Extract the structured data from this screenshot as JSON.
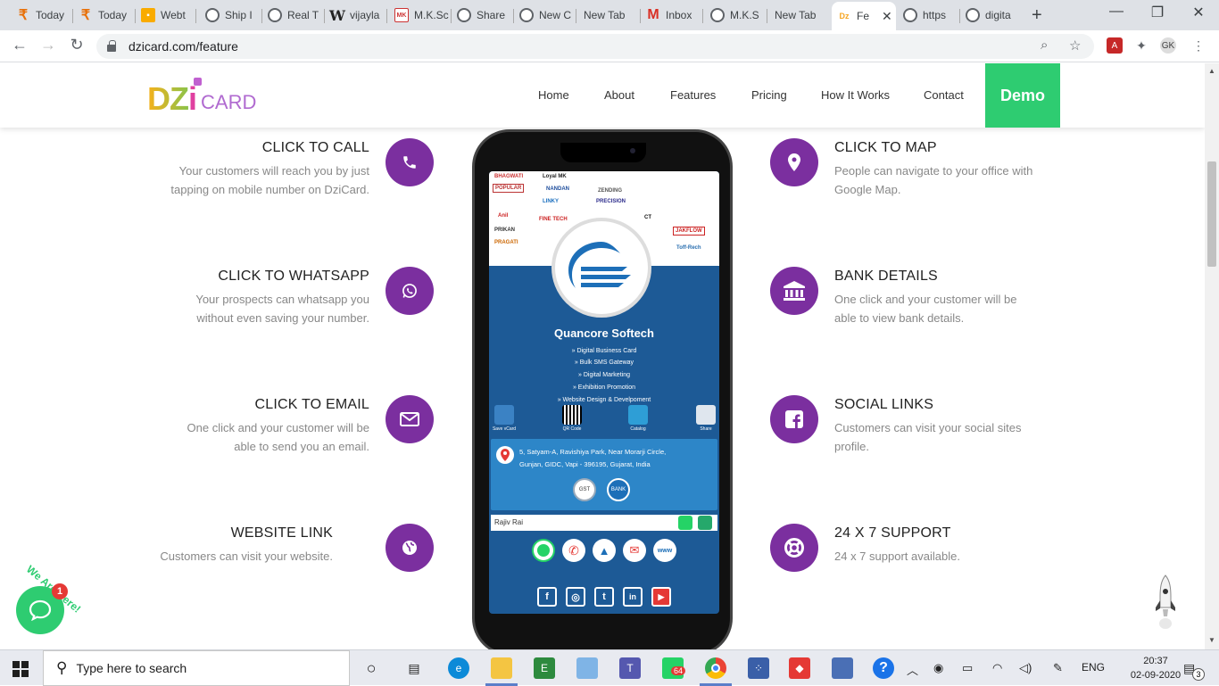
{
  "browser": {
    "tabs": [
      {
        "label": "Today",
        "icon": "rupee-icon"
      },
      {
        "label": "Today",
        "icon": "rupee-icon"
      },
      {
        "label": "Webt",
        "icon": "webtool-icon"
      },
      {
        "label": "Ship I",
        "icon": "globe-icon"
      },
      {
        "label": "Real T",
        "icon": "globe-icon"
      },
      {
        "label": "vijayla",
        "icon": "w-icon"
      },
      {
        "label": "M.K.Sc",
        "icon": "mk-icon"
      },
      {
        "label": "Share",
        "icon": "globe-icon"
      },
      {
        "label": "New C",
        "icon": "globe-icon"
      },
      {
        "label": "New Tab",
        "icon": "none"
      },
      {
        "label": "Inbox",
        "icon": "gmail-icon"
      },
      {
        "label": "M.K.S",
        "icon": "globe-icon"
      },
      {
        "label": "New Tab",
        "icon": "none"
      },
      {
        "label": "Fe",
        "icon": "dzicard-icon",
        "active": true
      },
      {
        "label": "https",
        "icon": "globe-icon"
      },
      {
        "label": "digita",
        "icon": "globe-icon"
      }
    ],
    "url": "dzicard.com/feature",
    "new_tab_label": "+",
    "window_minimize": "—",
    "window_maximize": "❐",
    "window_close": "✕",
    "tab_close": "✕"
  },
  "site": {
    "logo_dz": "DZ",
    "logo_i": "i",
    "logo_card": "CARD",
    "nav": [
      "Home",
      "About",
      "Features",
      "Pricing",
      "How It Works",
      "Contact"
    ],
    "demo_label": "Demo"
  },
  "features_left": [
    {
      "title": "CLICK TO CALL",
      "desc1": "Your customers will reach you by just",
      "desc2": "tapping on mobile number on DziCard.",
      "icon": "phone-icon"
    },
    {
      "title": "CLICK TO WHATSAPP",
      "desc1": "Your prospects can whatsapp you",
      "desc2": "without even saving your number.",
      "icon": "whatsapp-icon"
    },
    {
      "title": "CLICK TO EMAIL",
      "desc1": "One click and your customer will be",
      "desc2": "able to send you an email.",
      "icon": "envelope-icon"
    },
    {
      "title": "WEBSITE LINK",
      "desc1": "Customers can visit your website.",
      "desc2": "",
      "icon": "globe-icon"
    }
  ],
  "features_right": [
    {
      "title": "CLICK TO MAP",
      "desc1": "People can navigate to your office with",
      "desc2": "Google Map.",
      "icon": "map-pin-icon"
    },
    {
      "title": "BANK DETAILS",
      "desc1": "One click and your customer will be",
      "desc2": "able to view bank details.",
      "icon": "bank-icon"
    },
    {
      "title": "SOCIAL LINKS",
      "desc1": "Customers can visit your social sites",
      "desc2": "profile.",
      "icon": "facebook-icon"
    },
    {
      "title": "24 X 7 SUPPORT",
      "desc1": "24 x 7 support available.",
      "desc2": "",
      "icon": "lifebuoy-icon"
    }
  ],
  "phone": {
    "client_logos": [
      "BHAGWATI",
      "Loyal MK",
      "POPULAR",
      "NANDAN",
      "ZENDING",
      "LINKY",
      "PRECISION",
      "Anil",
      "FINE TECH",
      "CT",
      "PRIKAN",
      "JAKFLOW",
      "PRAGATI",
      "Toff-Rech"
    ],
    "business_name": "Quancore Softech",
    "services": [
      "» Digital Business Card",
      "» Bulk SMS Gateway",
      "» Digital Marketing",
      "» Exhibition Promotion",
      "» Website Design & Develpoment"
    ],
    "actions": [
      "Save vCard",
      "QR Code",
      "Catalog",
      "Share"
    ],
    "address_line1": "5, Satyam-A, Ravishiya Park, Near Morarji Circle,",
    "address_line2": "Gunjan, GIDC, Vapi - 396195, Gujarat, India",
    "gst_label": "GST",
    "bank_label": "BANK",
    "contact_name": "Rajiv Rai",
    "www_label": "www",
    "social": [
      "f",
      "◎",
      "t",
      "in",
      "▶"
    ]
  },
  "chat": {
    "badge": "1",
    "tagline": "We Are Here!"
  },
  "taskbar": {
    "search_placeholder": "Type here to search",
    "whatsapp_badge": "64",
    "help_label": "?",
    "lang": "ENG",
    "time": "20:37",
    "date": "02-09-2020",
    "notif_count": "3"
  },
  "colors": {
    "accent": "#7b2f9f",
    "demo_green": "#2ecc71",
    "card_blue": "#1d5a96"
  }
}
